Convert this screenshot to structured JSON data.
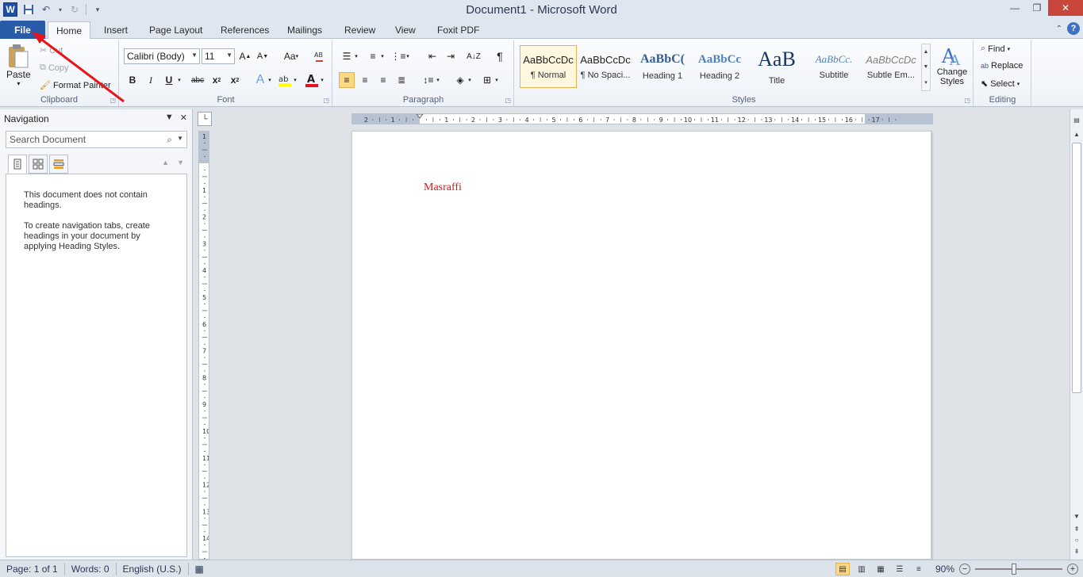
{
  "window": {
    "title": "Document1  -  Microsoft Word",
    "app_icon_letter": "W",
    "controls": [
      "minimize",
      "restore",
      "close"
    ]
  },
  "tabs": {
    "file": "File",
    "items": [
      "Home",
      "Insert",
      "Page Layout",
      "References",
      "Mailings",
      "Review",
      "View",
      "Foxit PDF"
    ],
    "active": "Home"
  },
  "ribbon": {
    "clipboard": {
      "label": "Clipboard",
      "paste": "Paste",
      "cut": "Cut",
      "copy": "Copy",
      "format_painter": "Format Painter"
    },
    "font": {
      "label": "Font",
      "font_name": "Calibri (Body)",
      "font_size": "11",
      "change_case": "Aa"
    },
    "paragraph": {
      "label": "Paragraph"
    },
    "styles": {
      "label": "Styles",
      "items": [
        {
          "preview": "AaBbCcDc",
          "name": "¶ Normal"
        },
        {
          "preview": "AaBbCcDc",
          "name": "¶ No Spaci..."
        },
        {
          "preview": "AaBbC(",
          "name": "Heading 1"
        },
        {
          "preview": "AaBbCc",
          "name": "Heading 2"
        },
        {
          "preview": "AaB",
          "name": "Title"
        },
        {
          "preview": "AaBbCc.",
          "name": "Subtitle"
        },
        {
          "preview": "AaBbCcDc",
          "name": "Subtle Em..."
        }
      ],
      "change_styles": "Change Styles"
    },
    "editing": {
      "label": "Editing",
      "find": "Find",
      "replace": "Replace",
      "select": "Select"
    }
  },
  "navigation": {
    "title": "Navigation",
    "search_placeholder": "Search Document",
    "message1": "This document does not contain headings.",
    "message2": "To create navigation tabs, create headings in your document by applying Heading Styles."
  },
  "document": {
    "text": "Masraffi",
    "text_color": "#d41a1a"
  },
  "status": {
    "page": "Page: 1 of 1",
    "words": "Words: 0",
    "language": "English (U.S.)",
    "zoom": "90%",
    "zoom_level_percent": 90
  },
  "colors": {
    "file_tab": "#2a5ba8",
    "annotation_arrow": "#e8141c",
    "highlight_pressed": "#fcd884"
  }
}
